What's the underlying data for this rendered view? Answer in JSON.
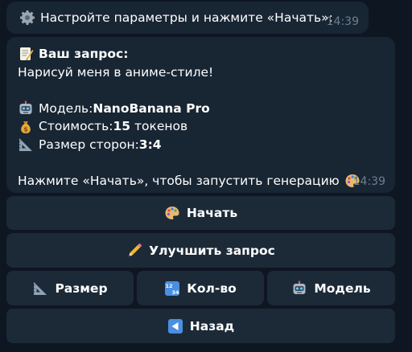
{
  "message1": {
    "icon": "gear-icon",
    "text": "Настройте параметры и нажмите «Начать»:",
    "time": "14:39"
  },
  "message2": {
    "heading_icon": "memo-icon",
    "heading": "Ваш запрос:",
    "prompt": "Нарисуй меня в аниме-стиле!",
    "model_icon": "robot-icon",
    "model_label": "Модель: ",
    "model_value": "NanoBanana Pro",
    "cost_icon": "money-bag-icon",
    "cost_label": "Стоимость: ",
    "cost_value": "15",
    "cost_unit": " токенов",
    "size_icon": "triangle-ruler-icon",
    "size_label": "Размер сторон: ",
    "size_value": "3:4",
    "footer": "Нажмите «Начать», чтобы запустить генерацию",
    "footer_icon": "palette-icon",
    "time": "14:39"
  },
  "keyboard": {
    "start": {
      "label": "Начать",
      "icon": "palette-icon"
    },
    "improve": {
      "label": "Улучшить запрос",
      "icon": "pencil-icon"
    },
    "size": {
      "label": "Размер",
      "icon": "triangle-ruler-icon"
    },
    "count": {
      "label": "Кол-во",
      "icon": "numbers-icon"
    },
    "model": {
      "label": "Модель",
      "icon": "robot-icon"
    },
    "back": {
      "label": "Назад",
      "icon": "left-arrow-icon"
    }
  },
  "colors": {
    "background": "#0e1621",
    "bubble": "#182533",
    "button": "#1c2a38",
    "timestamp": "#6d7f8f"
  }
}
